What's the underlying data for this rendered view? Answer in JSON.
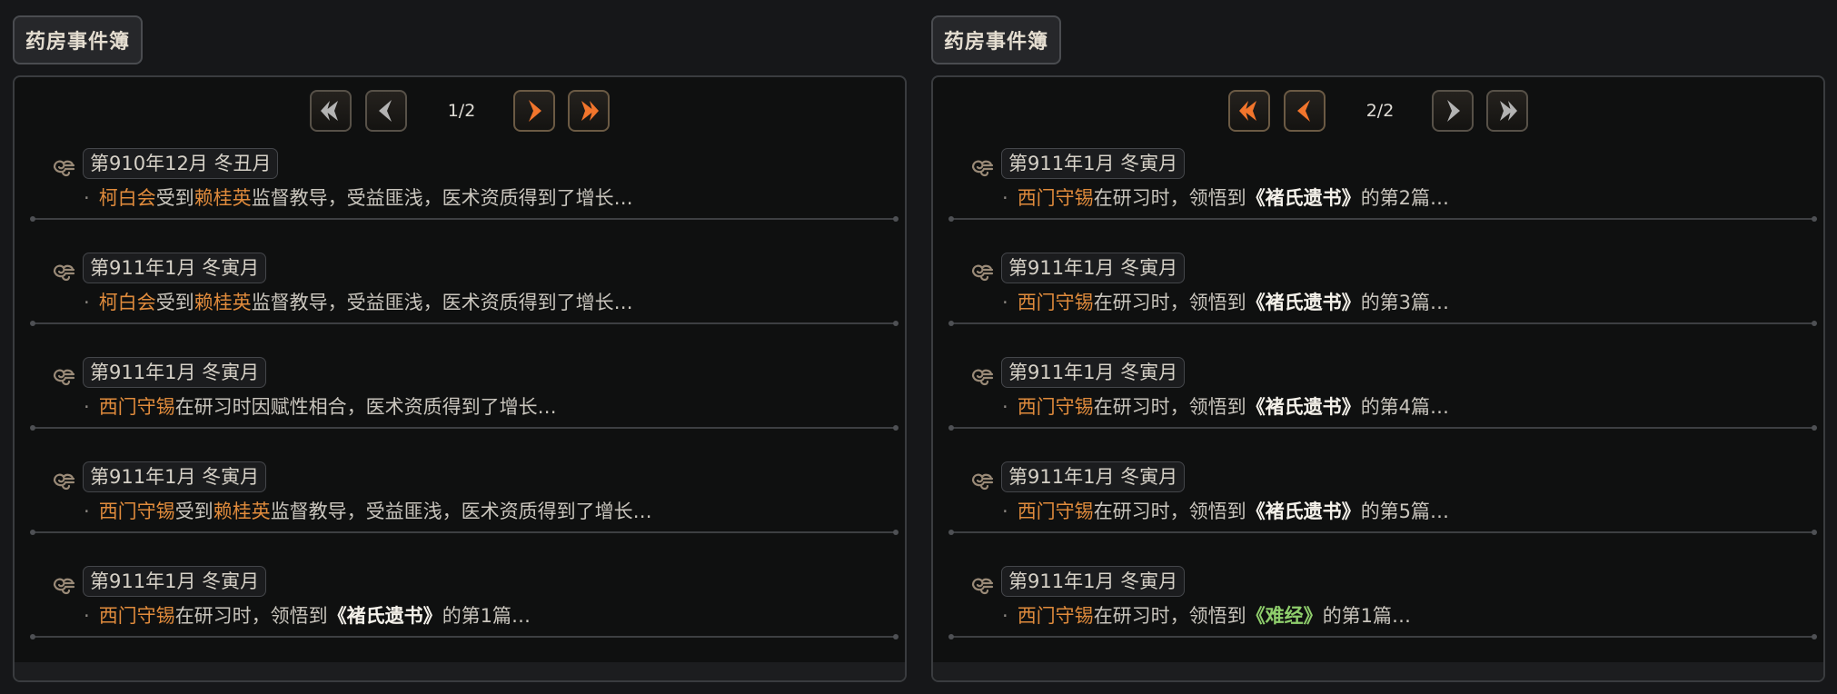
{
  "panels": [
    {
      "title": "药房事件簿",
      "page": "1/2",
      "prev_state": "dim",
      "next_state": "hot",
      "entries": [
        {
          "date": "第910年12月  冬丑月",
          "parts": [
            {
              "t": "柯白会",
              "c": "nm"
            },
            {
              "t": "受到",
              "c": ""
            },
            {
              "t": "赖桂英",
              "c": "nm"
            },
            {
              "t": "监督教导，受益匪浅，医术资质得到了增长…",
              "c": ""
            }
          ]
        },
        {
          "date": "第911年1月  冬寅月",
          "parts": [
            {
              "t": "柯白会",
              "c": "nm"
            },
            {
              "t": "受到",
              "c": ""
            },
            {
              "t": "赖桂英",
              "c": "nm"
            },
            {
              "t": "监督教导，受益匪浅，医术资质得到了增长…",
              "c": ""
            }
          ]
        },
        {
          "date": "第911年1月  冬寅月",
          "parts": [
            {
              "t": "西门守锡",
              "c": "nm"
            },
            {
              "t": "在研习时因赋性相合，医术资质得到了增长…",
              "c": ""
            }
          ]
        },
        {
          "date": "第911年1月  冬寅月",
          "parts": [
            {
              "t": "西门守锡",
              "c": "nm"
            },
            {
              "t": "受到",
              "c": ""
            },
            {
              "t": "赖桂英",
              "c": "nm"
            },
            {
              "t": "监督教导，受益匪浅，医术资质得到了增长…",
              "c": ""
            }
          ]
        },
        {
          "date": "第911年1月  冬寅月",
          "parts": [
            {
              "t": "西门守锡",
              "c": "nm"
            },
            {
              "t": "在研习时，领悟到",
              "c": ""
            },
            {
              "t": "《褚氏遗书》",
              "c": "bk"
            },
            {
              "t": "的第1篇…",
              "c": ""
            }
          ]
        }
      ]
    },
    {
      "title": "药房事件簿",
      "page": "2/2",
      "prev_state": "hot",
      "next_state": "dim",
      "entries": [
        {
          "date": "第911年1月  冬寅月",
          "parts": [
            {
              "t": "西门守锡",
              "c": "nm"
            },
            {
              "t": "在研习时，领悟到",
              "c": ""
            },
            {
              "t": "《褚氏遗书》",
              "c": "bk"
            },
            {
              "t": "的第2篇…",
              "c": ""
            }
          ]
        },
        {
          "date": "第911年1月  冬寅月",
          "parts": [
            {
              "t": "西门守锡",
              "c": "nm"
            },
            {
              "t": "在研习时，领悟到",
              "c": ""
            },
            {
              "t": "《褚氏遗书》",
              "c": "bk"
            },
            {
              "t": "的第3篇…",
              "c": ""
            }
          ]
        },
        {
          "date": "第911年1月  冬寅月",
          "parts": [
            {
              "t": "西门守锡",
              "c": "nm"
            },
            {
              "t": "在研习时，领悟到",
              "c": ""
            },
            {
              "t": "《褚氏遗书》",
              "c": "bk"
            },
            {
              "t": "的第4篇…",
              "c": ""
            }
          ]
        },
        {
          "date": "第911年1月  冬寅月",
          "parts": [
            {
              "t": "西门守锡",
              "c": "nm"
            },
            {
              "t": "在研习时，领悟到",
              "c": ""
            },
            {
              "t": "《褚氏遗书》",
              "c": "bk"
            },
            {
              "t": "的第5篇…",
              "c": ""
            }
          ]
        },
        {
          "date": "第911年1月  冬寅月",
          "parts": [
            {
              "t": "西门守锡",
              "c": "nm"
            },
            {
              "t": "在研习时，领悟到",
              "c": ""
            },
            {
              "t": "《难经》",
              "c": "bkg"
            },
            {
              "t": "的第1篇…",
              "c": ""
            }
          ]
        }
      ]
    }
  ],
  "icons": {
    "first": "first-page-icon",
    "prev": "prev-page-icon",
    "next": "next-page-icon",
    "last": "last-page-icon",
    "entry": "scroll-ornament-icon"
  },
  "colors": {
    "name_highlight": "#e08b3c",
    "book_title": "#f4f1ea",
    "book_title_alt": "#8fce6c",
    "active_arrow": "#f2752c",
    "inactive_arrow": "#b3b3b3"
  }
}
